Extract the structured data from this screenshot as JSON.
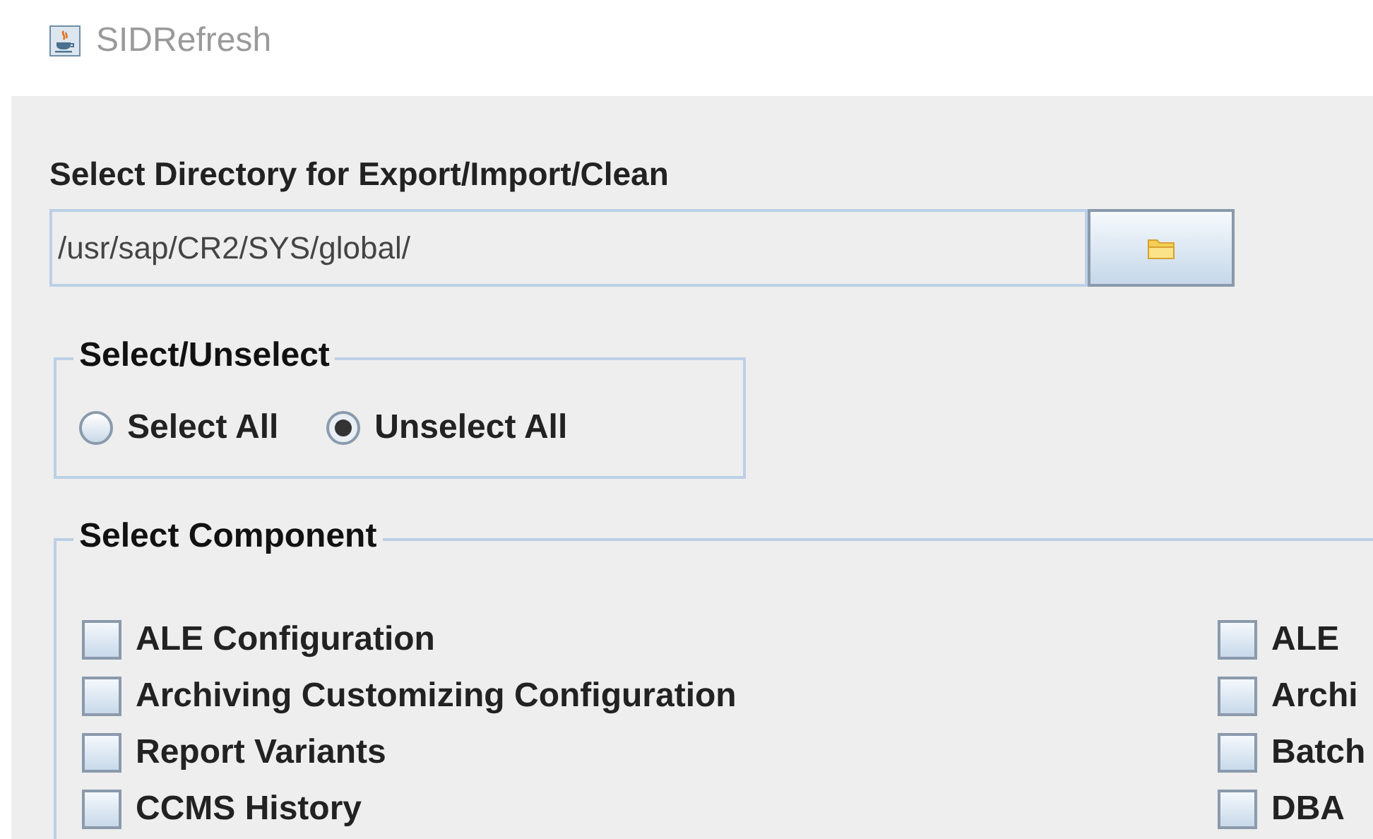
{
  "window": {
    "title": "SIDRefresh"
  },
  "directory": {
    "label": "Select Directory for Export/Import/Clean",
    "value": "/usr/sap/CR2/SYS/global/"
  },
  "select_unselect": {
    "title": "Select/Unselect",
    "options": [
      {
        "label": "Select All",
        "selected": false
      },
      {
        "label": "Unselect All",
        "selected": true
      }
    ]
  },
  "components": {
    "title": "Select Component",
    "columns": [
      [
        {
          "label": "ALE Configuration",
          "checked": false
        },
        {
          "label": "Archiving Customizing Configuration",
          "checked": false
        },
        {
          "label": "Report Variants",
          "checked": false
        },
        {
          "label": "CCMS History",
          "checked": false
        }
      ],
      [
        {
          "label": "ALE",
          "checked": false
        },
        {
          "label": "Archi",
          "checked": false
        },
        {
          "label": "Batch",
          "checked": false
        },
        {
          "label": "DBA",
          "checked": false
        }
      ]
    ]
  }
}
